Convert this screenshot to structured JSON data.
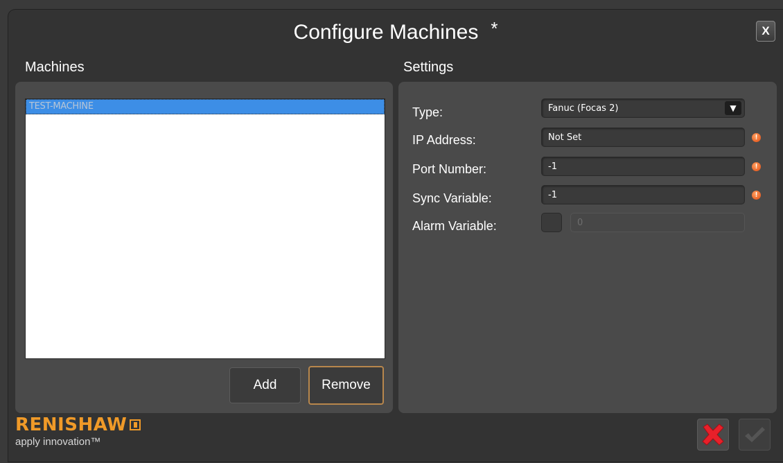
{
  "window": {
    "title": "Configure Machines",
    "modified_marker": "*",
    "close_label": "X"
  },
  "machines": {
    "heading": "Machines",
    "items": [
      "TEST-MACHINE"
    ],
    "selected_index": 0,
    "add_label": "Add",
    "remove_label": "Remove"
  },
  "settings": {
    "heading": "Settings",
    "type": {
      "label": "Type:",
      "value": "Fanuc (Focas 2)"
    },
    "ip_address": {
      "label": "IP Address:",
      "value": "Not Set",
      "warning": true
    },
    "port_number": {
      "label": "Port Number:",
      "value": "-1",
      "warning": true
    },
    "sync_variable": {
      "label": "Sync Variable:",
      "value": "-1",
      "warning": true
    },
    "alarm_variable": {
      "label": "Alarm Variable:",
      "value": "0",
      "enabled": false
    }
  },
  "branding": {
    "name": "RENISHAW",
    "tagline": "apply innovation™"
  },
  "icons": {
    "close": "close-icon",
    "cancel": "red-x-icon",
    "confirm": "checkmark-icon",
    "warning": "warning-icon",
    "dropdown": "chevron-down-icon"
  },
  "colors": {
    "accent": "#f09a28",
    "selection": "#3d8ee6",
    "warning": "#e04a10",
    "cancel": "#e8202a"
  }
}
